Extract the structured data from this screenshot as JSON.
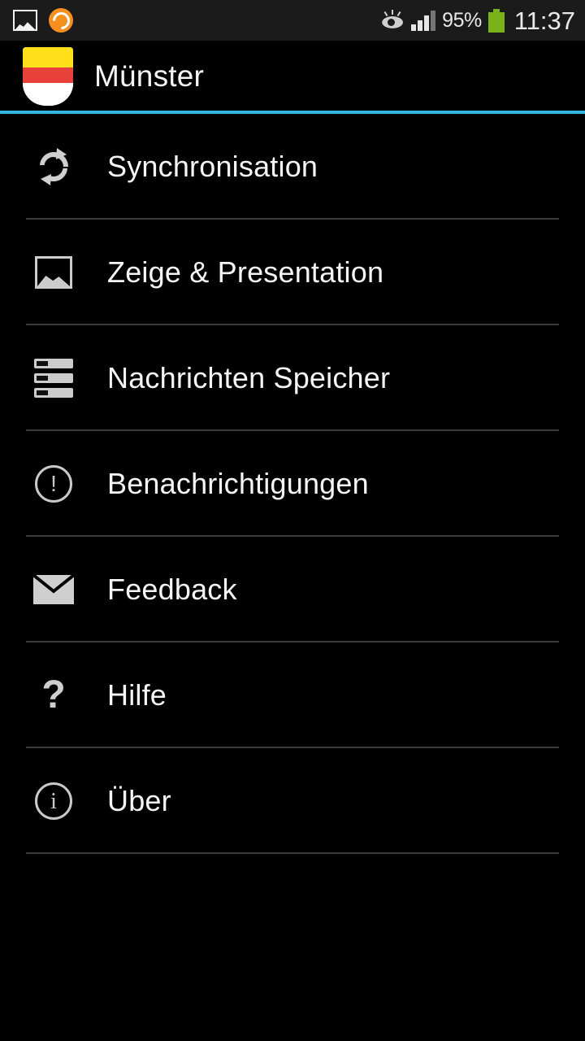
{
  "statusbar": {
    "left_icons": [
      {
        "name": "photo-icon",
        "label": "photo-icon"
      },
      {
        "name": "app-badge-icon",
        "label": "orange-app-icon"
      }
    ],
    "eye_icon": "smart-stay-eye-icon",
    "signal_icon": "signal-bars-icon",
    "signal_bars_total": 4,
    "signal_bars_active": 3,
    "battery_percent": "95%",
    "battery_icon": "battery-full-icon",
    "battery_color": "#7ab317",
    "clock": "11:37"
  },
  "header": {
    "logo_name": "muenster-coat-of-arms-icon",
    "title": "Münster",
    "accent_color": "#33b5e5",
    "crest_colors": {
      "top": "#ffe01b",
      "middle": "#e8413c",
      "bottom": "#ffffff"
    }
  },
  "menu": {
    "items": [
      {
        "label": "Synchronisation",
        "icon": "sync-icon"
      },
      {
        "label": "Zeige & Presentation",
        "icon": "image-icon"
      },
      {
        "label": "Nachrichten Speicher",
        "icon": "storage-icon"
      },
      {
        "label": "Benachrichtigungen",
        "icon": "alert-circle-icon"
      },
      {
        "label": "Feedback",
        "icon": "mail-icon"
      },
      {
        "label": "Hilfe",
        "icon": "question-mark-icon"
      },
      {
        "label": "Über",
        "icon": "info-circle-icon"
      }
    ]
  }
}
